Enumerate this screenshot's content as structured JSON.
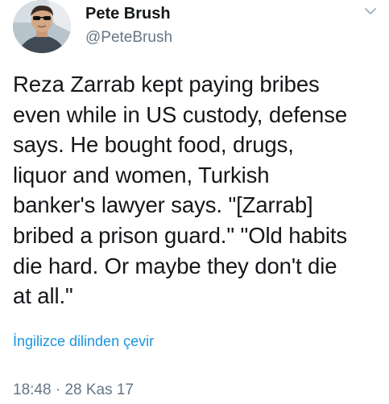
{
  "user": {
    "display_name": "Pete Brush",
    "handle": "@PeteBrush"
  },
  "tweet": {
    "text": "Reza Zarrab kept paying bribes\neven while in US custody, defense\nsays. He bought food, drugs,\nliquor and women, Turkish\nbanker's lawyer says. \"[Zarrab]\nbribed a prison guard.\" \"Old habits\ndie hard. Or maybe they don't die\nat all.\"",
    "translate_label": "İngilizce dilinden çevir",
    "time": "18:48",
    "separator": " · ",
    "date": "28 Kas 17"
  },
  "icons": {
    "menu": "chevron-down-icon"
  },
  "colors": {
    "link": "#1b95e0",
    "secondary": "#657786",
    "primary_text": "#14171a"
  }
}
